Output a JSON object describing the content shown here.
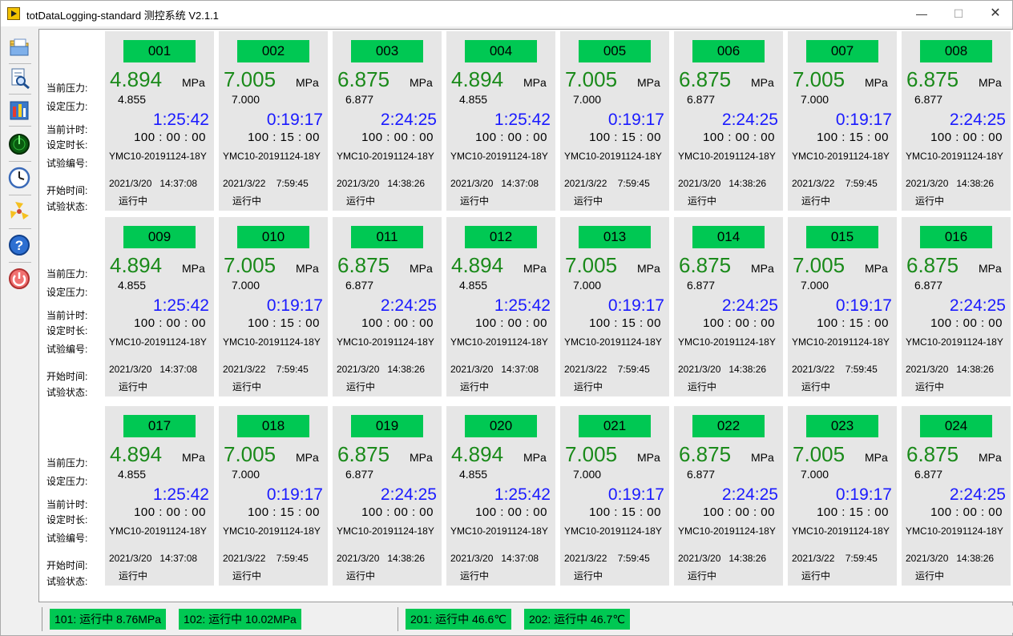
{
  "window": {
    "title": "totDataLogging-standard 测控系统 V2.1.1",
    "minimize": "—",
    "maximize": "☐",
    "close": "✕"
  },
  "toolbar": {
    "items": [
      "folder-icon",
      "search-document-icon",
      "settings-tools-icon",
      "radar-icon",
      "clock-icon",
      "fan-icon",
      "help-icon",
      "power-icon"
    ]
  },
  "labels": {
    "current_pressure": "当前压力:",
    "set_pressure": "设定压力:",
    "current_timer": "当前计时:",
    "set_duration": "设定时长:",
    "test_no": "试验编号:",
    "start_time": "开始时间:",
    "test_state": "试验状态:"
  },
  "unit": "MPa",
  "rows": [
    [
      {
        "id": "001",
        "pressure": "4.894",
        "set_pressure": "4.855",
        "timer": "1:25:42",
        "set_time": "100 : 00 : 00",
        "test_no": "YMC10-20191124-18Y",
        "start": "2021/3/20   14:37:08",
        "state": "运行中"
      },
      {
        "id": "002",
        "pressure": "7.005",
        "set_pressure": "7.000",
        "timer": "0:19:17",
        "set_time": "100 : 15 : 00",
        "test_no": "YMC10-20191124-18Y",
        "start": "2021/3/22    7:59:45",
        "state": "运行中"
      },
      {
        "id": "003",
        "pressure": "6.875",
        "set_pressure": "6.877",
        "timer": "2:24:25",
        "set_time": "100 : 00 : 00",
        "test_no": "YMC10-20191124-18Y",
        "start": "2021/3/20   14:38:26",
        "state": "运行中"
      },
      {
        "id": "004",
        "pressure": "4.894",
        "set_pressure": "4.855",
        "timer": "1:25:42",
        "set_time": "100 : 00 : 00",
        "test_no": "YMC10-20191124-18Y",
        "start": "2021/3/20   14:37:08",
        "state": "运行中"
      },
      {
        "id": "005",
        "pressure": "7.005",
        "set_pressure": "7.000",
        "timer": "0:19:17",
        "set_time": "100 : 15 : 00",
        "test_no": "YMC10-20191124-18Y",
        "start": "2021/3/22    7:59:45",
        "state": "运行中"
      },
      {
        "id": "006",
        "pressure": "6.875",
        "set_pressure": "6.877",
        "timer": "2:24:25",
        "set_time": "100 : 00 : 00",
        "test_no": "YMC10-20191124-18Y",
        "start": "2021/3/20   14:38:26",
        "state": "运行中"
      },
      {
        "id": "007",
        "pressure": "7.005",
        "set_pressure": "7.000",
        "timer": "0:19:17",
        "set_time": "100 : 15 : 00",
        "test_no": "YMC10-20191124-18Y",
        "start": "2021/3/22    7:59:45",
        "state": "运行中"
      },
      {
        "id": "008",
        "pressure": "6.875",
        "set_pressure": "6.877",
        "timer": "2:24:25",
        "set_time": "100 : 00 : 00",
        "test_no": "YMC10-20191124-18Y",
        "start": "2021/3/20   14:38:26",
        "state": "运行中"
      }
    ],
    [
      {
        "id": "009",
        "pressure": "4.894",
        "set_pressure": "4.855",
        "timer": "1:25:42",
        "set_time": "100 : 00 : 00",
        "test_no": "YMC10-20191124-18Y",
        "start": "2021/3/20   14:37:08",
        "state": "运行中"
      },
      {
        "id": "010",
        "pressure": "7.005",
        "set_pressure": "7.000",
        "timer": "0:19:17",
        "set_time": "100 : 15 : 00",
        "test_no": "YMC10-20191124-18Y",
        "start": "2021/3/22    7:59:45",
        "state": "运行中"
      },
      {
        "id": "011",
        "pressure": "6.875",
        "set_pressure": "6.877",
        "timer": "2:24:25",
        "set_time": "100 : 00 : 00",
        "test_no": "YMC10-20191124-18Y",
        "start": "2021/3/20   14:38:26",
        "state": "运行中"
      },
      {
        "id": "012",
        "pressure": "4.894",
        "set_pressure": "4.855",
        "timer": "1:25:42",
        "set_time": "100 : 00 : 00",
        "test_no": "YMC10-20191124-18Y",
        "start": "2021/3/20   14:37:08",
        "state": "运行中"
      },
      {
        "id": "013",
        "pressure": "7.005",
        "set_pressure": "7.000",
        "timer": "0:19:17",
        "set_time": "100 : 15 : 00",
        "test_no": "YMC10-20191124-18Y",
        "start": "2021/3/22    7:59:45",
        "state": "运行中"
      },
      {
        "id": "014",
        "pressure": "6.875",
        "set_pressure": "6.877",
        "timer": "2:24:25",
        "set_time": "100 : 00 : 00",
        "test_no": "YMC10-20191124-18Y",
        "start": "2021/3/20   14:38:26",
        "state": "运行中"
      },
      {
        "id": "015",
        "pressure": "7.005",
        "set_pressure": "7.000",
        "timer": "0:19:17",
        "set_time": "100 : 15 : 00",
        "test_no": "YMC10-20191124-18Y",
        "start": "2021/3/22    7:59:45",
        "state": "运行中"
      },
      {
        "id": "016",
        "pressure": "6.875",
        "set_pressure": "6.877",
        "timer": "2:24:25",
        "set_time": "100 : 00 : 00",
        "test_no": "YMC10-20191124-18Y",
        "start": "2021/3/20   14:38:26",
        "state": "运行中"
      }
    ],
    [
      {
        "id": "017",
        "pressure": "4.894",
        "set_pressure": "4.855",
        "timer": "1:25:42",
        "set_time": "100 : 00 : 00",
        "test_no": "YMC10-20191124-18Y",
        "start": "2021/3/20   14:37:08",
        "state": "运行中"
      },
      {
        "id": "018",
        "pressure": "7.005",
        "set_pressure": "7.000",
        "timer": "0:19:17",
        "set_time": "100 : 15 : 00",
        "test_no": "YMC10-20191124-18Y",
        "start": "2021/3/22    7:59:45",
        "state": "运行中"
      },
      {
        "id": "019",
        "pressure": "6.875",
        "set_pressure": "6.877",
        "timer": "2:24:25",
        "set_time": "100 : 00 : 00",
        "test_no": "YMC10-20191124-18Y",
        "start": "2021/3/20   14:38:26",
        "state": "运行中"
      },
      {
        "id": "020",
        "pressure": "4.894",
        "set_pressure": "4.855",
        "timer": "1:25:42",
        "set_time": "100 : 00 : 00",
        "test_no": "YMC10-20191124-18Y",
        "start": "2021/3/20   14:37:08",
        "state": "运行中"
      },
      {
        "id": "021",
        "pressure": "7.005",
        "set_pressure": "7.000",
        "timer": "0:19:17",
        "set_time": "100 : 15 : 00",
        "test_no": "YMC10-20191124-18Y",
        "start": "2021/3/22    7:59:45",
        "state": "运行中"
      },
      {
        "id": "022",
        "pressure": "6.875",
        "set_pressure": "6.877",
        "timer": "2:24:25",
        "set_time": "100 : 00 : 00",
        "test_no": "YMC10-20191124-18Y",
        "start": "2021/3/20   14:38:26",
        "state": "运行中"
      },
      {
        "id": "023",
        "pressure": "7.005",
        "set_pressure": "7.000",
        "timer": "0:19:17",
        "set_time": "100 : 15 : 00",
        "test_no": "YMC10-20191124-18Y",
        "start": "2021/3/22    7:59:45",
        "state": "运行中"
      },
      {
        "id": "024",
        "pressure": "6.875",
        "set_pressure": "6.877",
        "timer": "2:24:25",
        "set_time": "100 : 00 : 00",
        "test_no": "YMC10-20191124-18Y",
        "start": "2021/3/20   14:38:26",
        "state": "运行中"
      }
    ]
  ],
  "status": {
    "pills": [
      "101:  运行中  8.76MPa",
      "102:  运行中  10.02MPa",
      "201:  运行中   46.6℃",
      "202:  运行中  46.7℃"
    ]
  },
  "colors": {
    "id_badge": "#00c853",
    "pressure_text": "#1a8a1a",
    "timer_text": "#1a1aff",
    "card_bg": "#e6e6e6"
  }
}
